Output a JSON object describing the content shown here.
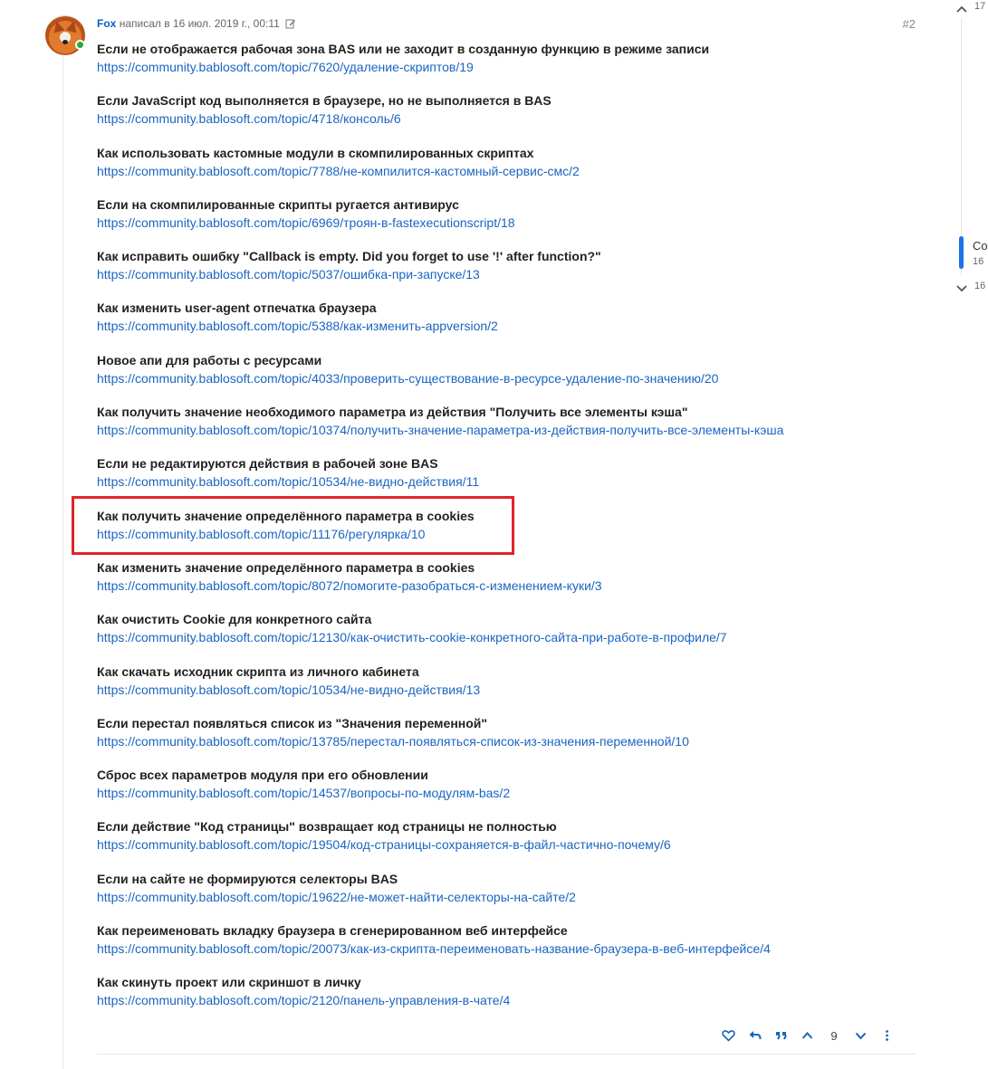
{
  "post": {
    "author": "Fox",
    "meta_text": "написал в 16 июл. 2019 г., 00:11",
    "post_number": "#2",
    "reaction_count": "9"
  },
  "entries": [
    {
      "title": "Если не отображается рабочая зона BAS или не заходит в созданную функцию в режиме записи",
      "url": "https://community.bablosoft.com/topic/7620/удаление-скриптов/19"
    },
    {
      "title": "Если JavaScript код выполняется в браузере, но не выполняется в BAS",
      "url": "https://community.bablosoft.com/topic/4718/консоль/6"
    },
    {
      "title": "Как использовать кастомные модули в скомпилированных скриптах",
      "url": "https://community.bablosoft.com/topic/7788/не-компилится-кастомный-сервис-смс/2"
    },
    {
      "title": "Если на скомпилированные скрипты ругается антивирус",
      "url": "https://community.bablosoft.com/topic/6969/троян-в-fastexecutionscript/18"
    },
    {
      "title": "Как исправить ошибку \"Callback is empty. Did you forget to use '!' after function?\"",
      "url": "https://community.bablosoft.com/topic/5037/ошибка-при-запуске/13"
    },
    {
      "title": "Как изменить user-agent отпечатка браузера",
      "url": "https://community.bablosoft.com/topic/5388/как-изменить-appversion/2"
    },
    {
      "title": "Новое апи для работы с ресурсами",
      "url": "https://community.bablosoft.com/topic/4033/проверить-существование-в-ресурсе-удаление-по-значению/20"
    },
    {
      "title": "Как получить значение необходимого параметра из действия \"Получить все элементы кэша\"",
      "url": "https://community.bablosoft.com/topic/10374/получить-значение-параметра-из-действия-получить-все-элементы-кэша"
    },
    {
      "title": "Если не редактируются действия в рабочей зоне BAS",
      "url": "https://community.bablosoft.com/topic/10534/не-видно-действия/11"
    },
    {
      "title": "Как получить значение определённого параметра в cookies",
      "url": "https://community.bablosoft.com/topic/11176/регулярка/10"
    },
    {
      "title": "Как изменить значение определённого параметра в cookies",
      "url": "https://community.bablosoft.com/topic/8072/помогите-разобраться-с-изменением-куки/3"
    },
    {
      "title": "Как очистить Cookie для конкретного сайта",
      "url": "https://community.bablosoft.com/topic/12130/как-очистить-cookie-конкретного-сайта-при-работе-в-профиле/7"
    },
    {
      "title": "Как скачать исходник скрипта из личного кабинета",
      "url": "https://community.bablosoft.com/topic/10534/не-видно-действия/13"
    },
    {
      "title": "Если перестал появляться список из \"Значения переменной\"",
      "url": "https://community.bablosoft.com/topic/13785/перестал-появляться-список-из-значения-переменной/10"
    },
    {
      "title": "Сброс всех параметров модуля при его обновлении",
      "url": "https://community.bablosoft.com/topic/14537/вопросы-по-модулям-bas/2"
    },
    {
      "title": "Если действие \"Код страницы\" возвращает код страницы не полностью",
      "url": "https://community.bablosoft.com/topic/19504/код-страницы-сохраняется-в-файл-частично-почему/6"
    },
    {
      "title": "Если на сайте не формируются селекторы BAS",
      "url": "https://community.bablosoft.com/topic/19622/не-может-найти-селекторы-на-сайте/2"
    },
    {
      "title": "Как переименовать вкладку браузера в сгенерированном веб интерфейсе",
      "url": "https://community.bablosoft.com/topic/20073/как-из-скрипта-переименовать-название-браузера-в-веб-интерфейсе/4"
    },
    {
      "title": "Как скинуть проект или скриншот в личку",
      "url": "https://community.bablosoft.com/topic/2120/панель-управления-в-чате/4"
    }
  ],
  "timeline": {
    "top_text": "17 ",
    "current_label": "Co",
    "current_sub": "16 ",
    "bottom_text": "16"
  },
  "colors": {
    "link": "#1a65c1",
    "highlight": "#e0242c",
    "online": "#2aa744",
    "timeline_handle": "#1a73e8"
  },
  "icons": [
    "edit-icon",
    "heart-icon",
    "reply-icon",
    "quote-icon",
    "upvote-icon",
    "downvote-icon",
    "more-icon",
    "chevron-up-icon",
    "chevron-down-icon"
  ]
}
